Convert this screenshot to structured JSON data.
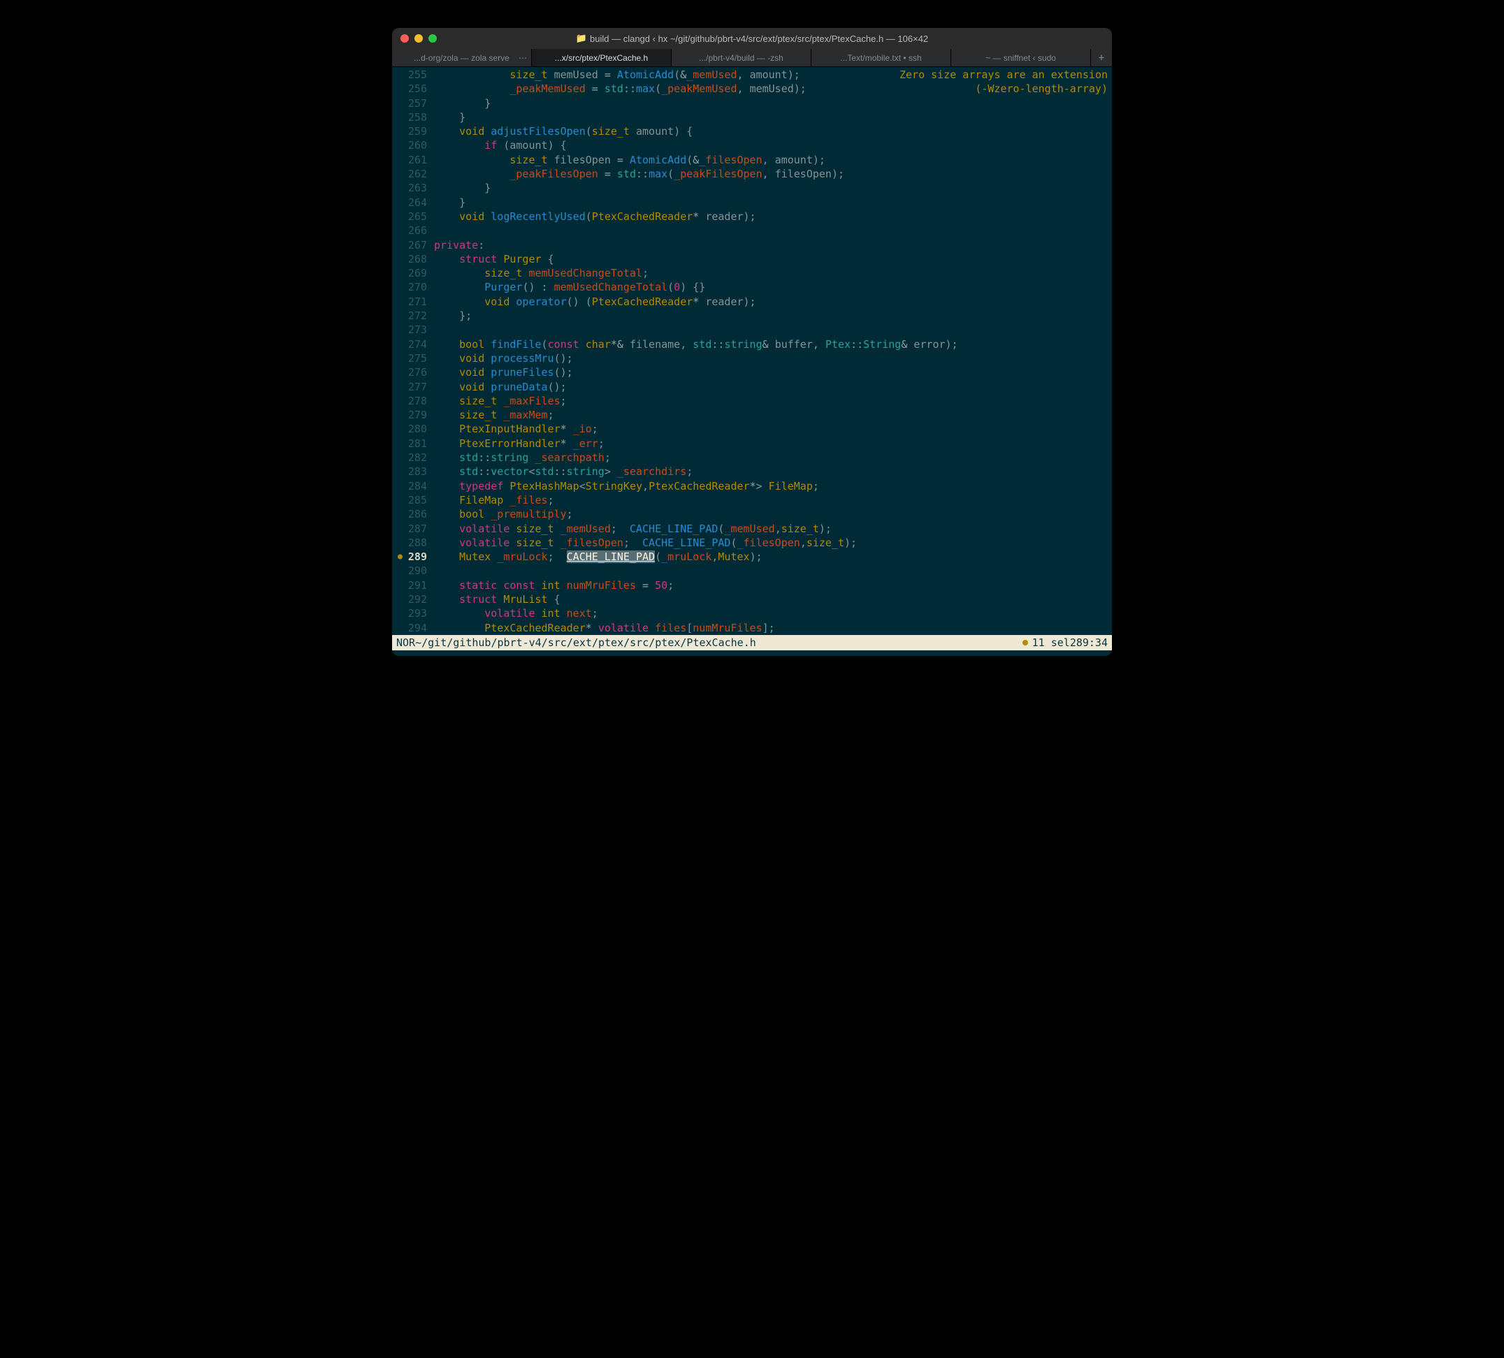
{
  "window": {
    "title": "build — clangd ‹ hx ~/git/github/pbrt-v4/src/ext/ptex/src/ptex/PtexCache.h — 106×42"
  },
  "tabs": {
    "items": [
      "...d-org/zola — zola serve",
      "...x/src/ptex/PtexCache.h",
      ".../pbrt-v4/build — -zsh",
      "...Text/mobile.txt • ssh",
      "~ — sniffnet ‹ sudo"
    ],
    "active_index": 1
  },
  "diagnostic": {
    "line1": "Zero size arrays are an extension",
    "line2": "(-Wzero-length-array)"
  },
  "statusbar": {
    "mode": "NOR",
    "path": "~/git/github/pbrt-v4/src/ext/ptex/src/ptex/PtexCache.h",
    "diag_count": "1",
    "sel": "1 sel",
    "pos": "289:34"
  },
  "selection": {
    "text": "CACHE_LINE_PAD"
  },
  "lines": {
    "255": "        size_t memUsed = AtomicAdd(&_memUsed, amount);",
    "256": "        _peakMemUsed = std::max(_peakMemUsed, memUsed);",
    "257": "    }",
    "258": "}",
    "259": "void adjustFilesOpen(size_t amount) {",
    "260": "    if (amount) {",
    "261": "        size_t filesOpen = AtomicAdd(&_filesOpen, amount);",
    "262": "        _peakFilesOpen = std::max(_peakFilesOpen, filesOpen);",
    "263": "    }",
    "264": "}",
    "265": "void logRecentlyUsed(PtexCachedReader* reader);",
    "266": "",
    "267": "private:",
    "268": "    struct Purger {",
    "269": "        size_t memUsedChangeTotal;",
    "270": "        Purger() : memUsedChangeTotal(0) {}",
    "271": "        void operator() (PtexCachedReader* reader);",
    "272": "    };",
    "273": "",
    "274": "    bool findFile(const char*& filename, std::string& buffer, Ptex::String& error);",
    "275": "    void processMru();",
    "276": "    void pruneFiles();",
    "277": "    void pruneData();",
    "278": "    size_t _maxFiles;",
    "279": "    size_t _maxMem;",
    "280": "    PtexInputHandler* _io;",
    "281": "    PtexErrorHandler* _err;",
    "282": "    std::string _searchpath;",
    "283": "    std::vector<std::string> _searchdirs;",
    "284": "    typedef PtexHashMap<StringKey,PtexCachedReader*> FileMap;",
    "285": "    FileMap _files;",
    "286": "    bool _premultiply;",
    "287": "    volatile size_t _memUsed;  CACHE_LINE_PAD(_memUsed,size_t);",
    "288": "    volatile size_t _filesOpen;  CACHE_LINE_PAD(_filesOpen,size_t);",
    "289": "    Mutex _mruLock;  CACHE_LINE_PAD(_mruLock,Mutex);",
    "290": "",
    "291": "    static const int numMruFiles = 50;",
    "292": "    struct MruList {",
    "293": "        volatile int next;",
    "294": "        PtexCachedReader* volatile files[numMruFiles];"
  },
  "gutter": {
    "start": 255,
    "end": 294,
    "current": 289
  }
}
